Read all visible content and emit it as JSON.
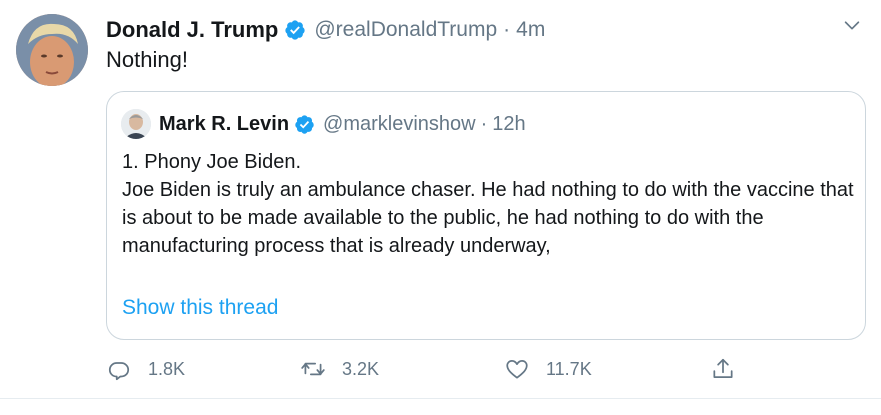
{
  "tweet": {
    "author_name": "Donald J. Trump",
    "author_handle": "@realDonaldTrump",
    "separator": "·",
    "time": "4m",
    "text": "Nothing!"
  },
  "quote": {
    "author_name": "Mark R. Levin",
    "author_handle": "@marklevinshow",
    "separator": "·",
    "time": "12h",
    "text": "1. Phony Joe Biden.\nJoe Biden is truly an ambulance chaser.  He had nothing to do with the vaccine that is about to be made available to the public, he had nothing to do with the manufacturing process that is already underway,",
    "thread_link": "Show this thread"
  },
  "actions": {
    "reply_count": "1.8K",
    "retweet_count": "3.2K",
    "like_count": "11.7K"
  },
  "icons": {
    "verified": "verified-badge-icon",
    "more": "chevron-down-icon",
    "reply": "reply-icon",
    "retweet": "retweet-icon",
    "like": "heart-icon",
    "share": "share-icon"
  },
  "colors": {
    "accent": "#1da1f2",
    "secondary_text": "#657786",
    "border": "#ccd6dd"
  }
}
